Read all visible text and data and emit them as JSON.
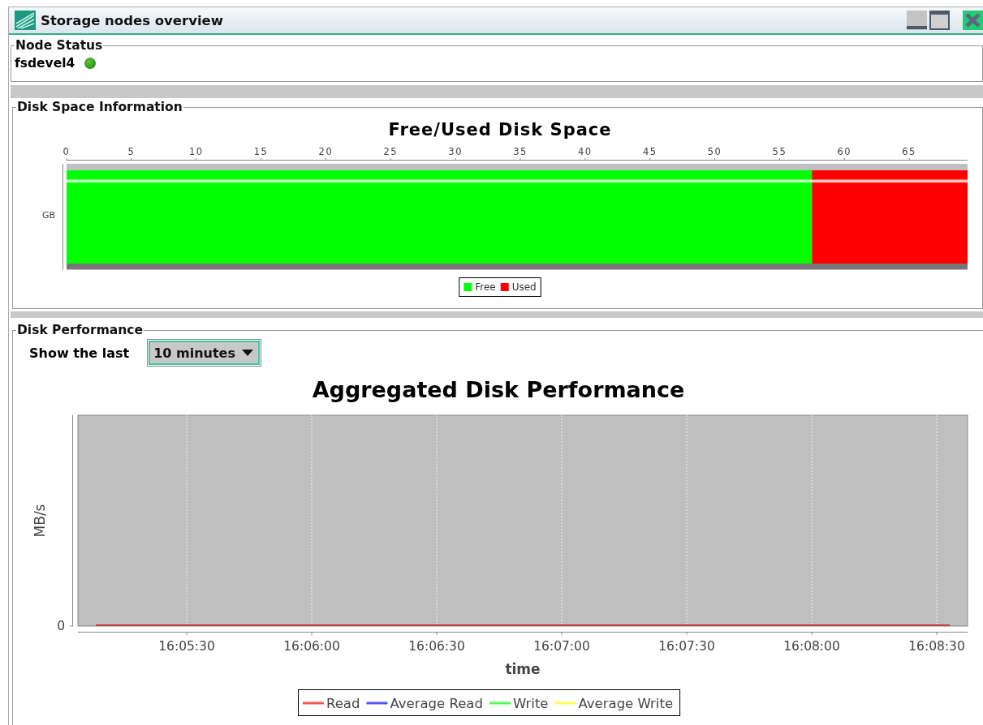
{
  "window": {
    "title": "Storage nodes overview"
  },
  "node_status": {
    "title": "Node Status",
    "nodes": [
      {
        "name": "fsdevel4",
        "online": true
      }
    ]
  },
  "disk_space": {
    "title": "Disk Space Information",
    "chart_data": {
      "type": "bar",
      "orientation": "horizontal",
      "stacked": true,
      "title": "Free/Used Disk Space",
      "categories": [
        "GB"
      ],
      "legend": "bottom",
      "series": [
        {
          "name": "Free",
          "color": "#00ff00",
          "values": [
            57.5
          ]
        },
        {
          "name": "Used",
          "color": "#ff0000",
          "values": [
            12.0
          ]
        }
      ],
      "xlim": [
        0,
        69.5
      ],
      "xticks": [
        0,
        5,
        10,
        15,
        20,
        25,
        30,
        35,
        40,
        45,
        50,
        55,
        60,
        65
      ]
    }
  },
  "disk_performance": {
    "title": "Disk Performance",
    "range_label": "Show the last",
    "range": {
      "value": "10 minutes"
    },
    "chart": {
      "title": "Aggregated Disk Performance",
      "xlabel": "time",
      "ylabel": "MB/s",
      "y_tick_labels": [
        "0"
      ],
      "x_tick_labels": [
        "16:05:30",
        "16:06:00",
        "16:06:30",
        "16:07:00",
        "16:07:30",
        "16:08:00",
        "16:08:30"
      ],
      "legend": [
        {
          "name": "Read",
          "color": "#ff5555"
        },
        {
          "name": "Average Read",
          "color": "#5555ff"
        },
        {
          "name": "Write",
          "color": "#55ff55"
        },
        {
          "name": "Average Write",
          "color": "#ffff55"
        }
      ]
    }
  }
}
